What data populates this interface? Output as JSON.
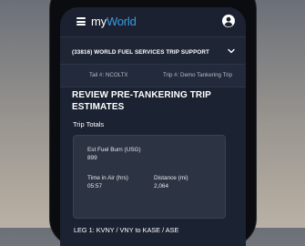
{
  "header": {
    "logo_my": "my",
    "logo_world": "World",
    "menu_icon": "hamburger-menu-icon",
    "account_icon": "user-account-icon"
  },
  "trip_bar": {
    "title": "(33816) WORLD FUEL SERVICES TRIP SUPPORT",
    "chevron_icon": "chevron-down-icon"
  },
  "meta": {
    "tail": "Tail #: NCOLTX",
    "trip_number": "Trip #: Demo Tankering Trip"
  },
  "page": {
    "title": "REVIEW PRE-TANKERING TRIP ESTIMATES",
    "trip_totals_label": "Trip Totals"
  },
  "totals": {
    "est_fuel_burn_label": "Est Fuel Burn (USG)",
    "est_fuel_burn_value": "899",
    "time_in_air_label": "Time in Air (hrs)",
    "time_in_air_value": "05:57",
    "distance_label": "Distance (mi)",
    "distance_value": "2,064"
  },
  "leg": {
    "label": "LEG 1: KVNY / VNY to KASE / ASE"
  },
  "colors": {
    "header_bg": "#1b2130",
    "screen_bg": "#1b2231",
    "card_bg": "#2c3343",
    "brand_blue": "#3a9be0"
  }
}
